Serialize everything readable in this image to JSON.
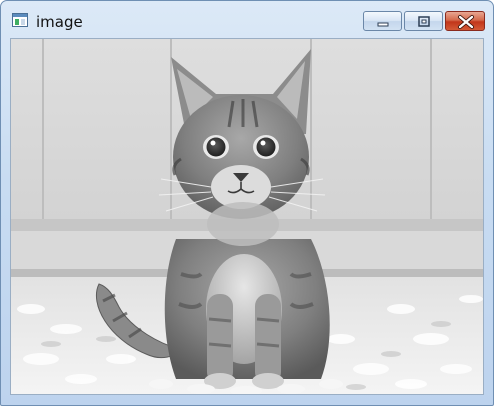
{
  "window": {
    "title": "image",
    "app_icon": "image-window-icon",
    "controls": {
      "minimize_icon": "minimize-icon",
      "maximize_icon": "maximize-icon",
      "close_icon": "close-icon"
    },
    "close_color": "#c94a2e"
  },
  "content": {
    "image_subject": "kitten-photo-grayscale"
  }
}
